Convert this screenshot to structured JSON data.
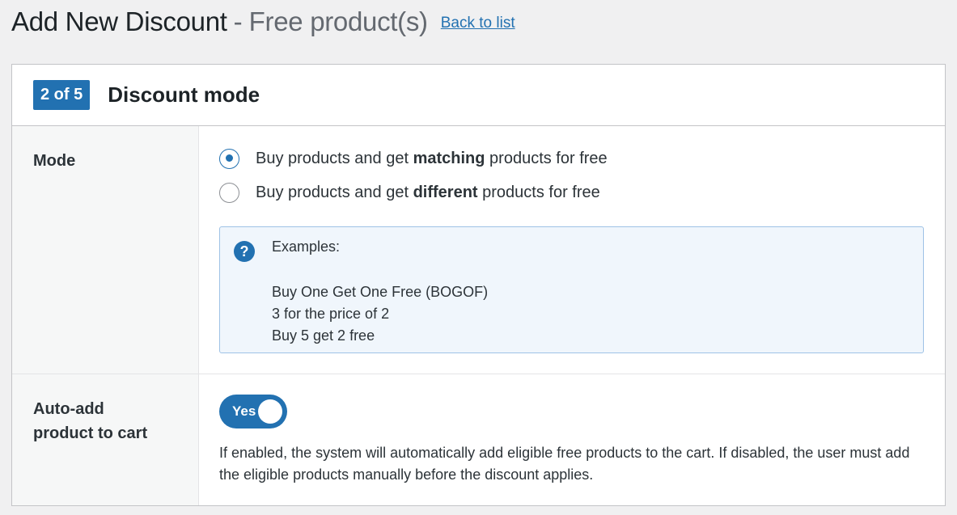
{
  "header": {
    "title": "Add New Discount",
    "separator": "-",
    "subtitle": "Free product(s)",
    "back_link": "Back to list"
  },
  "panel": {
    "step_badge": "2 of 5",
    "title": "Discount mode"
  },
  "mode": {
    "label": "Mode",
    "options": [
      {
        "prefix": "Buy products and get ",
        "bold": "matching",
        "suffix": " products for free",
        "selected": true
      },
      {
        "prefix": "Buy products and get ",
        "bold": "different",
        "suffix": " products for free",
        "selected": false
      }
    ],
    "examples": {
      "title": "Examples:",
      "items": [
        "Buy One Get One Free (BOGOF)",
        "3 for the price of 2",
        "Buy 5 get 2 free"
      ]
    }
  },
  "auto_add": {
    "label_line1": "Auto-add",
    "label_line2": "product to cart",
    "toggle_label": "Yes",
    "toggle_on": true,
    "help": "If enabled, the system will automatically add eligible free products to the cart. If disabled, the user must add the eligible products manually before the discount applies."
  },
  "colors": {
    "accent": "#2271b1",
    "info_bg": "#f0f6fc",
    "info_border": "#9ec2e6",
    "label_bg": "#f6f7f7",
    "page_bg": "#f0f0f1"
  },
  "icons": {
    "help": "question-circle-icon"
  }
}
